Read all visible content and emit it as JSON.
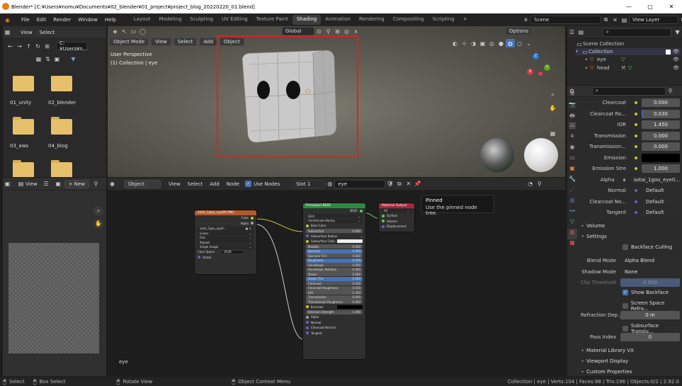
{
  "window": {
    "title": "Blender* [C:¥Users¥nomu¥Documents¥02_blender¥01_project¥project_blog_20220220_01.blend]",
    "minimize": "—",
    "maximize": "▢",
    "close": "✕"
  },
  "menu": [
    "File",
    "Edit",
    "Render",
    "Window",
    "Help"
  ],
  "workspaces": [
    "Layout",
    "Modeling",
    "Sculpting",
    "UV Editing",
    "Texture Paint",
    "Shading",
    "Animation",
    "Rendering",
    "Compositing",
    "Scripting",
    "+"
  ],
  "scene": {
    "scene_name": "Scene",
    "view_layer": "View Layer"
  },
  "file_browser": {
    "header_items": [
      "View",
      "Select"
    ],
    "path": "C:¥Users¥n...",
    "folders": [
      "01_unity",
      "02_blender",
      "03_aws",
      "04_blog",
      "",
      ""
    ]
  },
  "image_editor": {
    "view": "View",
    "new_button": "+ New"
  },
  "viewport": {
    "mode": "Object Mode",
    "menus": [
      "View",
      "Select",
      "Add",
      "Object"
    ],
    "transform": "Global",
    "options": "Options",
    "overlay_title": "User Perspective",
    "overlay_sub": "(1) Collection | eye",
    "gizmo": {
      "x": "X",
      "y": "Y",
      "z": "Z"
    }
  },
  "outliner": {
    "root": "Scene Collection",
    "collection": "Collection",
    "items": [
      "eye",
      "head"
    ]
  },
  "node_editor": {
    "type": "Object",
    "menus": [
      "View",
      "Select",
      "Add",
      "Node"
    ],
    "use_nodes": "Use Nodes",
    "slot": "Slot 1",
    "material": "eye",
    "footer": "eye",
    "tooltip_title": "Pinned",
    "tooltip_body": "Use the pinned node tree.",
    "image_node": {
      "title": "sotai_1gou_eye00.PNG",
      "out_color": "Color",
      "out_alpha": "Alpha",
      "image": "sotai_1gou_eye0...",
      "options": [
        "Linear",
        "Flat",
        "Repeat",
        "Single Image"
      ],
      "color_space_label": "Color Space",
      "color_space": "sRGB",
      "in_vector": "Vector"
    },
    "bsdf_node": {
      "title": "Principled BSDF",
      "out": "BSDF",
      "dist": "GGX",
      "sss": "Christensen-Burley",
      "rows": [
        [
          "Base Color",
          ""
        ],
        [
          "Subsurface",
          "0.000"
        ],
        [
          "Subsurface Radius",
          ""
        ],
        [
          "Subsurface Color",
          ""
        ],
        [
          "Metallic",
          "0.000"
        ],
        [
          "Specular",
          "0.500"
        ],
        [
          "Specular Tint",
          "0.000"
        ],
        [
          "Roughness",
          "0.500"
        ],
        [
          "Anisotropic",
          "0.000"
        ],
        [
          "Anisotropic Rotation",
          "0.000"
        ],
        [
          "Sheen",
          "0.000"
        ],
        [
          "Sheen Tint",
          "0.500"
        ],
        [
          "Clearcoat",
          "0.000"
        ],
        [
          "Clearcoat Roughness",
          "0.030"
        ],
        [
          "IOR",
          "1.450"
        ],
        [
          "Transmission",
          "0.000"
        ],
        [
          "Transmission Roughness",
          "0.000"
        ],
        [
          "Emission",
          ""
        ],
        [
          "Emission Strength",
          "1.000"
        ],
        [
          "Alpha",
          ""
        ],
        [
          "Normal",
          ""
        ],
        [
          "Clearcoat Normal",
          ""
        ],
        [
          "Tangent",
          ""
        ]
      ]
    },
    "output_node": {
      "title": "Material Output",
      "target": "All",
      "inputs": [
        "Surface",
        "Volume",
        "Displacement"
      ]
    }
  },
  "properties": {
    "rows": [
      {
        "label": "Clearcoat",
        "value": "0.000"
      },
      {
        "label": "Clearcoat Ro...",
        "value": "0.030"
      },
      {
        "label": "IOR",
        "value": "1.450"
      },
      {
        "label": "Transmission",
        "value": "0.000"
      },
      {
        "label": "Transmission...",
        "value": "0.000"
      },
      {
        "label": "Emission",
        "value": ""
      },
      {
        "label": "Emission Stre",
        "value": "1.000"
      },
      {
        "label": "Alpha",
        "value": "sotai_1gou_eye0..."
      },
      {
        "label": "Normal",
        "value": "Default"
      },
      {
        "label": "Clearcoat No...",
        "value": "Default"
      },
      {
        "label": "Tangent",
        "value": "Default"
      }
    ],
    "sections": {
      "volume": "Volume",
      "settings": "Settings",
      "material_library": "Material Library VX",
      "viewport_display": "Viewport Display",
      "custom_properties": "Custom Properties"
    },
    "settings": {
      "backface_culling": "Backface Culling",
      "blend_mode_label": "Blend Mode",
      "blend_mode": "Alpha Blend",
      "shadow_mode_label": "Shadow Mode",
      "shadow_mode": "None",
      "clip_label": "Clip Threshold",
      "clip_value": "0.500",
      "show_backface": "Show Backface",
      "screen_space": "Screen Space Refra...",
      "refraction_label": "Refraction Dep...",
      "refraction_value": "0 m",
      "sss_translucency": "Subsurface Translu...",
      "pass_index_label": "Pass Index",
      "pass_index": "0"
    }
  },
  "statusbar": {
    "select": "Select",
    "box_select": "Box Select",
    "rotate": "Rotate View",
    "context": "Object Context Menu",
    "stats": "Collection | eye | Verts:104 | Faces:98 | Tris:196 | Objects:0/2 | 2.92.0"
  },
  "colors": {
    "accent": "#4772b3",
    "highlight_box": "#e02020"
  }
}
